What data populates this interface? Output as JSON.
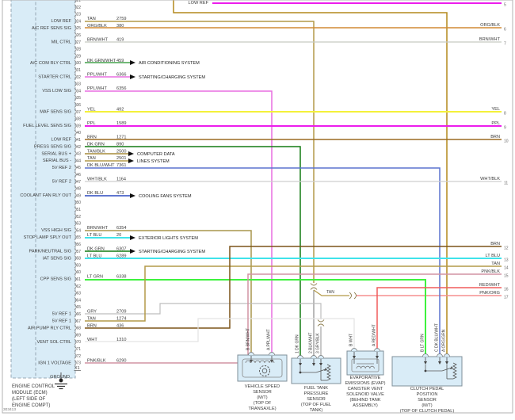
{
  "diagram": {
    "figure_number": "303413",
    "source_label": "LOW REF",
    "tan_splice_label": "TAN"
  },
  "colors": {
    "TAN": "#b49a48",
    "ORG/BLK": "#d28a33",
    "BRN/WHT": "#c6c9c2",
    "BRN/WHT2": "#a9964d",
    "DK GRN/WHT": "#43a24b",
    "PPL/WHT": "#e96fe0",
    "YEL": "#f4f13a",
    "PPL": "#ec1dec",
    "BRN": "#9b6b23",
    "BRN2": "#7c5418",
    "DK GRN": "#147c14",
    "TAN/BLK": "#a68b3a",
    "DK BLU/WHT": "#5b74cf",
    "WHT/BLK": "#cfcfcf",
    "DK BLU": "#2c49c0",
    "LT BLU": "#3fe3ea",
    "LT GRN": "#3ef23e",
    "GRY": "#bdbdbd",
    "WHT": "#e3e3e3",
    "PNK/BLK": "#d294a4",
    "RED/WHT": "#f15b5b",
    "PNK/ORG": "#f58f8f",
    "ORG/GRN": "#b3891c",
    "GRY/BLK": "#a3a3a3",
    "BLK/WHT": "#8c8c8c",
    "ecm_fill": "#d9ecf7",
    "dash_border": "#98a8b6",
    "page_border": "#b2b2b2",
    "text": "#3a3a3a",
    "dark_text": "#1a1a1a"
  },
  "ecm": {
    "caption": [
      "ENGINE CONTROL",
      "MODULE (ECM)",
      "(LEFT SIDE OF",
      "ENGINE COMPT)"
    ],
    "ground_label": "GROUND",
    "connector_label": "X1",
    "pins": [
      {
        "n": "21",
        "label": "",
        "wire": "",
        "circuit": ""
      },
      {
        "n": "22",
        "label": "",
        "wire": "",
        "circuit": ""
      },
      {
        "n": "23",
        "label": "",
        "wire": "",
        "circuit": ""
      },
      {
        "n": "24",
        "label": "LOW REF",
        "wire": "TAN",
        "circuit": "2759"
      },
      {
        "n": "25",
        "label": "A/C REF SENS SIG",
        "wire": "ORG/BLK",
        "circuit": "380"
      },
      {
        "n": "26",
        "label": "",
        "wire": "",
        "circuit": ""
      },
      {
        "n": "27",
        "label": "MIL CTRL",
        "wire": "BRN/WHT",
        "circuit": "419"
      },
      {
        "n": "28",
        "label": "",
        "wire": "",
        "circuit": ""
      },
      {
        "n": "29",
        "label": "",
        "wire": "",
        "circuit": ""
      },
      {
        "n": "30",
        "label": "A/C COM RLY CTRL",
        "wire": "DK GRN/WHT",
        "circuit": "459"
      },
      {
        "n": "31",
        "label": "",
        "wire": "",
        "circuit": ""
      },
      {
        "n": "32",
        "label": "STARTER CTRL",
        "wire": "PPL/WHT",
        "circuit": "6366"
      },
      {
        "n": "33",
        "label": "",
        "wire": "",
        "circuit": ""
      },
      {
        "n": "34",
        "label": "VSS LOW SIG",
        "wire": "PPL/WHT",
        "circuit": "6356"
      },
      {
        "n": "35",
        "label": "",
        "wire": "",
        "circuit": ""
      },
      {
        "n": "36",
        "label": "",
        "wire": "",
        "circuit": ""
      },
      {
        "n": "37",
        "label": "MAF SENS SIG",
        "wire": "YEL",
        "circuit": "492"
      },
      {
        "n": "38",
        "label": "",
        "wire": "",
        "circuit": ""
      },
      {
        "n": "39",
        "label": "FUEL LEVEL SENS SIG",
        "wire": "PPL",
        "circuit": "1589"
      },
      {
        "n": "40",
        "label": "",
        "wire": "",
        "circuit": ""
      },
      {
        "n": "41",
        "label": "LOW REF",
        "wire": "BRN",
        "circuit": "1271"
      },
      {
        "n": "42",
        "label": "PRESS SENS SIG",
        "wire": "DK GRN",
        "circuit": "890"
      },
      {
        "n": "43",
        "label": "SERIAL BUS +",
        "wire": "TAN/BLK",
        "circuit": "2500"
      },
      {
        "n": "44",
        "label": "SERIAL BUS -",
        "wire": "TAN",
        "circuit": "2501"
      },
      {
        "n": "45",
        "label": "5V REF 2",
        "wire": "DK BLU/WHT",
        "circuit": "7361"
      },
      {
        "n": "46",
        "label": "",
        "wire": "",
        "circuit": ""
      },
      {
        "n": "47",
        "label": "5V REF 2",
        "wire": "WHT/BLK",
        "circuit": "1164"
      },
      {
        "n": "48",
        "label": "",
        "wire": "",
        "circuit": ""
      },
      {
        "n": "49",
        "label": "COOLANT FAN RLY OUT",
        "wire": "DK BLU",
        "circuit": "473"
      },
      {
        "n": "50",
        "label": "",
        "wire": "",
        "circuit": ""
      },
      {
        "n": "51",
        "label": "",
        "wire": "",
        "circuit": ""
      },
      {
        "n": "52",
        "label": "",
        "wire": "",
        "circuit": ""
      },
      {
        "n": "53",
        "label": "",
        "wire": "",
        "circuit": ""
      },
      {
        "n": "54",
        "label": "VSS HIGH SIG",
        "wire": "BRN/WHT",
        "circuit": "6354"
      },
      {
        "n": "55",
        "label": "STOP LAMP SPLY OUT",
        "wire": "LT BLU",
        "circuit": "20"
      },
      {
        "n": "56",
        "label": "",
        "wire": "",
        "circuit": ""
      },
      {
        "n": "57",
        "label": "PARK/NEUTRAL SIG",
        "wire": "DK GRN",
        "circuit": "6307"
      },
      {
        "n": "58",
        "label": "IAT SENS SIG",
        "wire": "LT BLU",
        "circuit": "6289"
      },
      {
        "n": "59",
        "label": "",
        "wire": "",
        "circuit": ""
      },
      {
        "n": "60",
        "label": "",
        "wire": "",
        "circuit": ""
      },
      {
        "n": "61",
        "label": "CPP SENS SIG",
        "wire": "LT GRN",
        "circuit": "6338"
      },
      {
        "n": "62",
        "label": "",
        "wire": "",
        "circuit": ""
      },
      {
        "n": "63",
        "label": "",
        "wire": "",
        "circuit": ""
      },
      {
        "n": "64",
        "label": "",
        "wire": "",
        "circuit": ""
      },
      {
        "n": "65",
        "label": "",
        "wire": "",
        "circuit": ""
      },
      {
        "n": "66",
        "label": "5V REF 1",
        "wire": "GRY",
        "circuit": "2709"
      },
      {
        "n": "67",
        "label": "5V REF 1",
        "wire": "TAN",
        "circuit": "1274"
      },
      {
        "n": "68",
        "label": "AIR PUMP RLY CTRL",
        "wire": "BRN",
        "circuit": "436"
      },
      {
        "n": "69",
        "label": "",
        "wire": "",
        "circuit": ""
      },
      {
        "n": "70",
        "label": "VENT SOL CTRL",
        "wire": "WHT",
        "circuit": "1310"
      },
      {
        "n": "71",
        "label": "",
        "wire": "",
        "circuit": ""
      },
      {
        "n": "72",
        "label": "",
        "wire": "",
        "circuit": ""
      },
      {
        "n": "73",
        "label": "IGN 1 VOLTAGE",
        "wire": "PNK/BLK",
        "circuit": "6290"
      }
    ]
  },
  "system_links": [
    {
      "label": "AIR CONDITIONING SYSTEM"
    },
    {
      "label": "STARTING/CHARGING SYSTEM"
    },
    {
      "label": "COMPUTER DATA"
    },
    {
      "label": "LINES SYSTEM"
    },
    {
      "label": "COOLING FANS SYSTEM"
    },
    {
      "label": "EXTERIOR LIGHTS SYSTEM"
    },
    {
      "label": "STARTING/CHARGING SYSTEM"
    }
  ],
  "edge_refs": [
    {
      "num": "5",
      "color": ""
    },
    {
      "num": "6",
      "color": "ORG/BLK"
    },
    {
      "num": "7",
      "color": "BRN/WHT"
    },
    {
      "num": "8",
      "color": "YEL"
    },
    {
      "num": "9",
      "color": "PPL"
    },
    {
      "num": "10",
      "color": "BRN"
    },
    {
      "num": "11",
      "color": "WHT/BLK"
    },
    {
      "num": "12",
      "color": "BRN"
    },
    {
      "num": "13",
      "color": "LT BLU"
    },
    {
      "num": "14",
      "color": "TAN"
    },
    {
      "num": "15",
      "color": "PNK/BLK"
    },
    {
      "num": "16",
      "color": "RED/WHT"
    },
    {
      "num": "17",
      "color": "PNK/ORG"
    }
  ],
  "sensors": {
    "vss": {
      "caption": [
        "VEHICLE SPEED",
        "SENSOR",
        "(M/T)",
        "(TOP OF",
        "TRANSAXLE)"
      ],
      "pins": [
        {
          "id": "B",
          "color": "BRN/WHT"
        },
        {
          "id": "A",
          "color": "PPL/WHT"
        }
      ]
    },
    "ftp": {
      "caption": [
        "FUEL TANK",
        "PRESSURE",
        "SENSOR",
        "(TOP OF FUEL",
        "TANK)"
      ],
      "pins": [
        {
          "id": "1",
          "color": "DK GRN"
        },
        {
          "id": "2",
          "color": "BLK/WHT"
        },
        {
          "id": "3",
          "color": "GRY/BLK"
        }
      ]
    },
    "evap": {
      "caption": [
        "EVAPORATIVE",
        "EMISSIONS (EVAP)",
        "CANISTER VENT",
        "SOLENOID VALVE",
        "(BEHIND TANK",
        "ASSEMBLY)"
      ],
      "pins": [
        {
          "id": "B",
          "color": "WHT"
        },
        {
          "id": "A",
          "color": "RED/WHT"
        }
      ]
    },
    "cpp": {
      "caption": [
        "CLUTCH PEDAL",
        "POSITION",
        "SENSOR",
        "(M/T)",
        "(TOP OF CLUTCH PEDAL)"
      ],
      "pins": [
        {
          "id": "B",
          "color": "LT GRN"
        },
        {
          "id": "C",
          "color": "DK BLU/WHT"
        },
        {
          "id": "A",
          "color": "ORG/GRN"
        }
      ]
    }
  }
}
